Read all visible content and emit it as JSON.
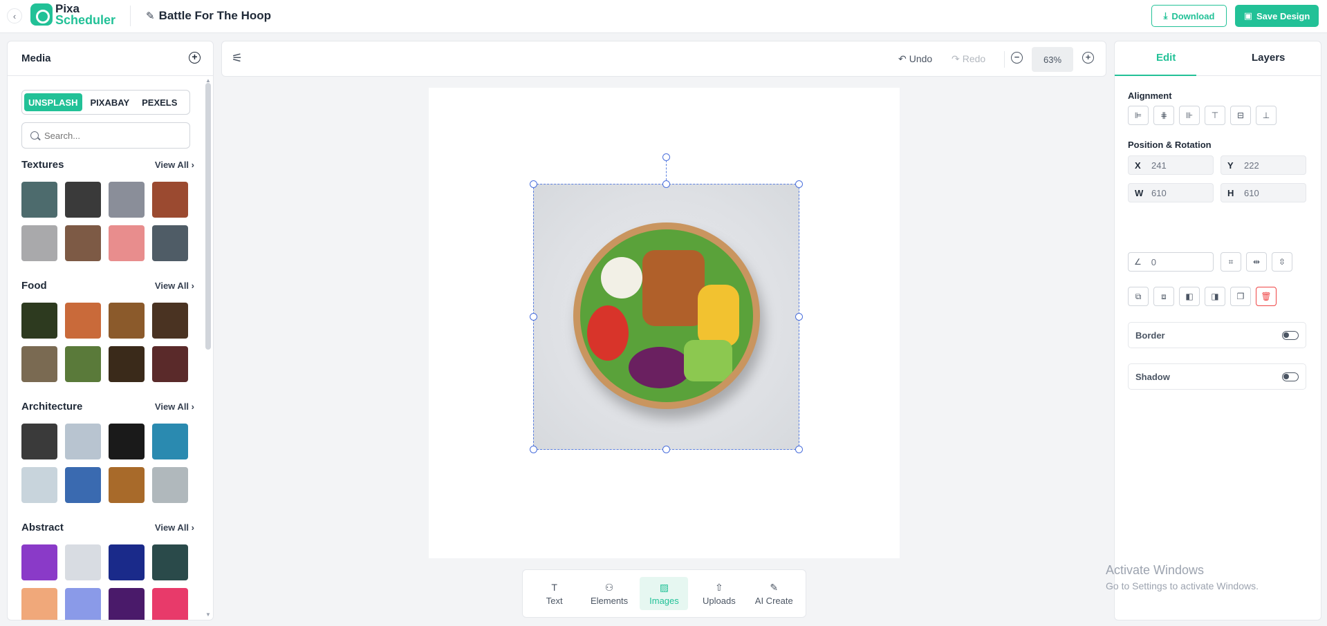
{
  "app": {
    "logo_line1": "Pixa",
    "logo_line2": "Scheduler",
    "doc_title": "Battle For The Hoop"
  },
  "header": {
    "download_label": "Download",
    "save_label": "Save Design"
  },
  "media_panel": {
    "title": "Media",
    "sources": [
      "UNSPLASH",
      "PIXABAY",
      "PEXELS"
    ],
    "active_source": "UNSPLASH",
    "search_placeholder": "Search...",
    "view_all_label": "View All",
    "categories": [
      {
        "name": "Textures",
        "thumb_colors": [
          "#4d6b6d",
          "#3a3a3a",
          "#8a8e99",
          "#9b4a30",
          "#a9a9ab",
          "#7d5a45",
          "#e88d8d",
          "#4f5c66"
        ]
      },
      {
        "name": "Food",
        "thumb_colors": [
          "#2d3a1f",
          "#c96a3a",
          "#8b5a2b",
          "#4a3322",
          "#7a6a52",
          "#5a7a3a",
          "#3a2a1a",
          "#5a2a2a"
        ]
      },
      {
        "name": "Architecture",
        "thumb_colors": [
          "#3a3a3a",
          "#b8c4d0",
          "#1a1a1a",
          "#2a8ab0",
          "#c8d4dc",
          "#3a6ab0",
          "#a86a2a",
          "#b0b8bc"
        ]
      },
      {
        "name": "Abstract",
        "thumb_colors": [
          "#8a3ac8",
          "#d8dce2",
          "#1a2a8a",
          "#2a4a4a",
          "#f0a87a",
          "#8a9ae8",
          "#4a1a6a",
          "#e83a6a"
        ]
      }
    ]
  },
  "toolbar": {
    "undo_label": "Undo",
    "redo_label": "Redo",
    "zoom_value": "63%"
  },
  "dock": {
    "items": [
      {
        "label": "Text",
        "icon": "text-icon",
        "glyph": "T"
      },
      {
        "label": "Elements",
        "icon": "elements-icon",
        "glyph": "⚇"
      },
      {
        "label": "Images",
        "icon": "image-icon",
        "glyph": "▨"
      },
      {
        "label": "Uploads",
        "icon": "upload-icon",
        "glyph": "⇧"
      },
      {
        "label": "AI Create",
        "icon": "magic-wand-icon",
        "glyph": "✎"
      }
    ],
    "active": "Images"
  },
  "properties": {
    "tabs": [
      "Edit",
      "Layers"
    ],
    "active_tab": "Edit",
    "alignment_label": "Alignment",
    "position_label": "Position & Rotation",
    "x_label": "X",
    "x_value": "241",
    "y_label": "Y",
    "y_value": "222",
    "w_label": "W",
    "w_value": "610",
    "h_label": "H",
    "h_value": "610",
    "rotation_value": "0",
    "border_label": "Border",
    "shadow_label": "Shadow"
  },
  "watermark": {
    "line1": "Activate Windows",
    "line2": "Go to Settings to activate Windows."
  },
  "colors": {
    "accent": "#22c197",
    "selection": "#4a6fdc",
    "danger": "#ef4444"
  }
}
